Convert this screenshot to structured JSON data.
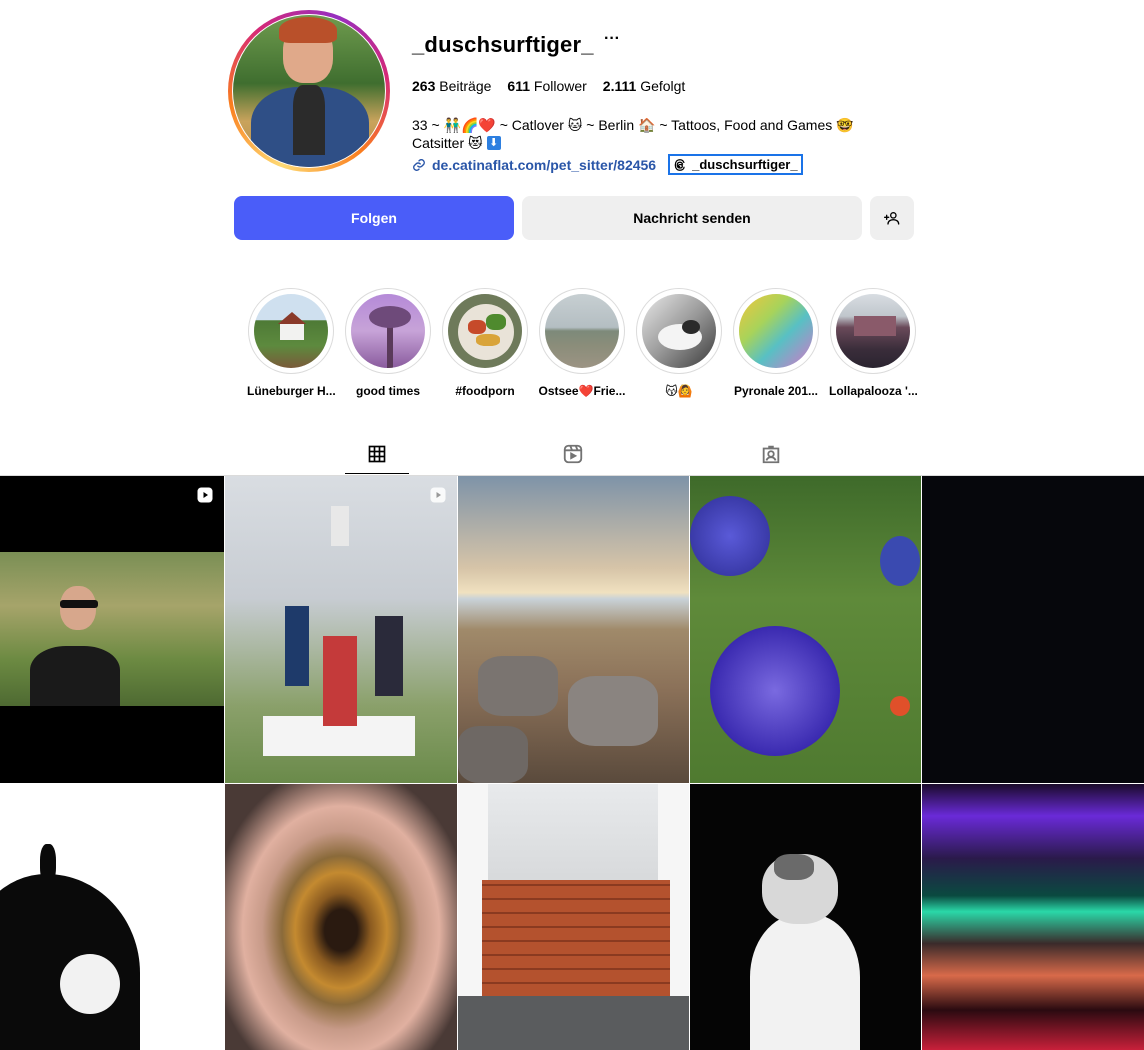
{
  "profile": {
    "username": "_duschsurftiger_",
    "more_label": "···",
    "stats": {
      "posts_count": "263",
      "posts_label": "Beiträge",
      "followers_count": "611",
      "followers_label": "Follower",
      "following_count": "2.111",
      "following_label": "Gefolgt"
    },
    "bio_line1": "33 ~ 👬🌈❤️ ~ Catlover 🐱 ~ Berlin 🏠 ~ Tattoos, Food and Games 🤓",
    "bio_line2": "Catsitter 😻",
    "bio_arrow": "⬇",
    "link": "de.catinaflat.com/pet_sitter/82456",
    "threads_handle": "_duschsurftiger_"
  },
  "actions": {
    "follow": "Folgen",
    "message": "Nachricht senden"
  },
  "highlights": [
    {
      "label": "Lüneburger H..."
    },
    {
      "label": "good times"
    },
    {
      "label": "#foodporn"
    },
    {
      "label": "Ostsee❤️Frie..."
    },
    {
      "label": "😽🙆"
    },
    {
      "label": "Pyronale 201..."
    },
    {
      "label": "Lollapalooza '..."
    }
  ],
  "tabs": [
    "posts-grid-icon",
    "reels-icon",
    "tagged-icon"
  ],
  "colors": {
    "follow_button": "#4a5df9",
    "secondary_button": "#efefef",
    "link": "#2a56a8",
    "threads_outline": "#1a73e8"
  }
}
